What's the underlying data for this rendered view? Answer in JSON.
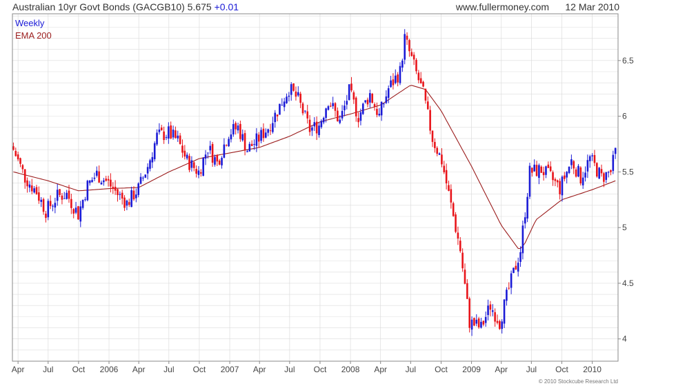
{
  "header": {
    "title": "Australian 10yr Govt Bonds (GACGB10)",
    "last": "5.675",
    "change": "+0.01",
    "site": "www.fullermoney.com",
    "date": "12 Mar 2010"
  },
  "footer": {
    "copyright": "© 2010 Stockcube Research Ltd"
  },
  "colors": {
    "up": "#1a1ad6",
    "down": "#e8141a",
    "ema": "#9b1c1c",
    "grid": "#dcdcdc",
    "legend_weekly": "#1a1ad6",
    "legend_ema": "#9b1c1c"
  },
  "chart_data": {
    "type": "candlestick",
    "legend": [
      "Weekly",
      "EMA 200"
    ],
    "ylim": [
      3.8,
      6.92
    ],
    "y_ticks": [
      4,
      4.5,
      5,
      5.5,
      6,
      6.5
    ],
    "y_tick_labels": [
      "4",
      "4.5",
      "5",
      "5.5",
      "6",
      "6.5"
    ],
    "x_tick_labels": [
      "Apr",
      "Jul",
      "Oct",
      "2006",
      "Apr",
      "Jul",
      "Oct",
      "2007",
      "Apr",
      "Jul",
      "Oct",
      "2008",
      "Apr",
      "Jul",
      "Oct",
      "2009",
      "Apr",
      "Jul",
      "Oct",
      "2010"
    ],
    "x_range_months": [
      "2005-03-15",
      "2010-03-20"
    ],
    "grid": true,
    "legend_position": "top-left",
    "series_points": [
      [
        "2005-03-18",
        5.7
      ],
      [
        "2005-04-22",
        5.45
      ],
      [
        "2005-05-27",
        5.32
      ],
      [
        "2005-06-24",
        5.15
      ],
      [
        "2005-07-29",
        5.28
      ],
      [
        "2005-08-26",
        5.3
      ],
      [
        "2005-09-30",
        5.12
      ],
      [
        "2005-10-28",
        5.38
      ],
      [
        "2005-11-25",
        5.48
      ],
      [
        "2005-12-30",
        5.4
      ],
      [
        "2006-01-27",
        5.3
      ],
      [
        "2006-02-24",
        5.22
      ],
      [
        "2006-03-31",
        5.35
      ],
      [
        "2006-04-28",
        5.55
      ],
      [
        "2006-05-26",
        5.82
      ],
      [
        "2006-06-30",
        5.85
      ],
      [
        "2006-07-28",
        5.78
      ],
      [
        "2006-08-25",
        5.6
      ],
      [
        "2006-09-29",
        5.5
      ],
      [
        "2006-10-27",
        5.72
      ],
      [
        "2006-11-24",
        5.58
      ],
      [
        "2006-12-29",
        5.85
      ],
      [
        "2007-01-26",
        5.9
      ],
      [
        "2007-02-23",
        5.7
      ],
      [
        "2007-03-30",
        5.8
      ],
      [
        "2007-04-27",
        5.9
      ],
      [
        "2007-05-25",
        6.05
      ],
      [
        "2007-06-29",
        6.25
      ],
      [
        "2007-07-27",
        6.15
      ],
      [
        "2007-08-31",
        5.88
      ],
      [
        "2007-09-28",
        5.92
      ],
      [
        "2007-10-26",
        6.15
      ],
      [
        "2007-11-30",
        5.95
      ],
      [
        "2007-12-28",
        6.22
      ],
      [
        "2008-01-25",
        6.0
      ],
      [
        "2008-02-29",
        6.2
      ],
      [
        "2008-03-28",
        6.0
      ],
      [
        "2008-04-25",
        6.25
      ],
      [
        "2008-05-30",
        6.4
      ],
      [
        "2008-06-13",
        6.7
      ],
      [
        "2008-07-11",
        6.45
      ],
      [
        "2008-08-08",
        6.2
      ],
      [
        "2008-09-05",
        5.8
      ],
      [
        "2008-10-03",
        5.6
      ],
      [
        "2008-10-31",
        5.2
      ],
      [
        "2008-11-28",
        4.8
      ],
      [
        "2008-12-26",
        4.15
      ],
      [
        "2009-01-30",
        4.1
      ],
      [
        "2009-02-27",
        4.3
      ],
      [
        "2009-03-27",
        4.15
      ],
      [
        "2009-04-24",
        4.45
      ],
      [
        "2009-05-29",
        4.8
      ],
      [
        "2009-06-26",
        5.5
      ],
      [
        "2009-07-31",
        5.52
      ],
      [
        "2009-08-28",
        5.45
      ],
      [
        "2009-09-25",
        5.35
      ],
      [
        "2009-10-30",
        5.6
      ],
      [
        "2009-11-27",
        5.45
      ],
      [
        "2009-12-25",
        5.62
      ],
      [
        "2010-01-29",
        5.45
      ],
      [
        "2010-02-26",
        5.5
      ],
      [
        "2010-03-12",
        5.675
      ]
    ],
    "ema_points": [
      [
        "2005-03-18",
        5.5
      ],
      [
        "2005-07-01",
        5.42
      ],
      [
        "2005-10-01",
        5.33
      ],
      [
        "2006-01-01",
        5.35
      ],
      [
        "2006-04-01",
        5.36
      ],
      [
        "2006-07-01",
        5.5
      ],
      [
        "2006-10-01",
        5.62
      ],
      [
        "2007-01-01",
        5.67
      ],
      [
        "2007-04-01",
        5.72
      ],
      [
        "2007-07-01",
        5.82
      ],
      [
        "2007-10-01",
        5.95
      ],
      [
        "2008-01-01",
        6.02
      ],
      [
        "2008-04-01",
        6.1
      ],
      [
        "2008-07-01",
        6.28
      ],
      [
        "2008-08-15",
        6.24
      ],
      [
        "2008-10-01",
        6.05
      ],
      [
        "2009-01-01",
        5.55
      ],
      [
        "2009-04-01",
        5.02
      ],
      [
        "2009-05-25",
        4.8
      ],
      [
        "2009-06-10",
        4.85
      ],
      [
        "2009-07-15",
        5.07
      ],
      [
        "2009-10-01",
        5.25
      ],
      [
        "2010-01-01",
        5.34
      ],
      [
        "2010-03-12",
        5.42
      ]
    ]
  }
}
